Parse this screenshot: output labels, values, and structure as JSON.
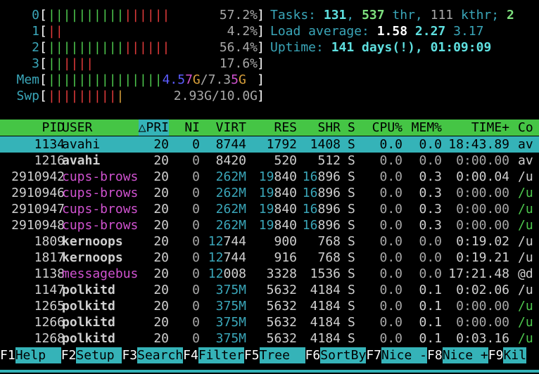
{
  "meters": [
    {
      "label": "0",
      "value": "57.2%",
      "segments": [
        [
          "g",
          "||||||||||"
        ],
        [
          "r",
          "||||||"
        ]
      ]
    },
    {
      "label": "1",
      "value": "4.2%",
      "segments": [
        [
          "r",
          "||"
        ]
      ]
    },
    {
      "label": "2",
      "value": "56.4%",
      "segments": [
        [
          "g",
          "||||||||||"
        ],
        [
          "r",
          "||||||"
        ]
      ]
    },
    {
      "label": "3",
      "value": "17.6%",
      "segments": [
        [
          "g",
          "||"
        ],
        [
          "r",
          "||||"
        ]
      ]
    },
    {
      "label": "Mem",
      "value": "",
      "segments": [
        [
          "g",
          "|||||||||||||||"
        ],
        [
          "b",
          "4.5"
        ],
        [
          "m",
          "7"
        ],
        [
          "o",
          "G"
        ],
        [
          "wt",
          "/7.3"
        ],
        [
          "m",
          "5"
        ],
        [
          "o",
          "G"
        ]
      ]
    },
    {
      "label": "Swp",
      "value": "2.93G/10.0G",
      "segments": [
        [
          "r",
          "|||||||||"
        ],
        [
          "o",
          "|"
        ]
      ]
    }
  ],
  "info": {
    "tasks_label": "Tasks: ",
    "tasks": "131",
    "sep1": ", ",
    "threads": "537",
    "thr_label": " thr, ",
    "kthreads": "111",
    "kthr_label": " kthr; ",
    "running": "2",
    "load_label": "Load average: ",
    "load1": "1.58",
    "load5": "2.27",
    "load15": "3.17",
    "uptime_label": "Uptime: ",
    "uptime": "141 days(!), 01:09:09"
  },
  "columns": {
    "pid": "PID",
    "user": "USER",
    "pri": "△PRI",
    "ni": "NI",
    "virt": "VIRT",
    "res": "RES",
    "shr": "SHR",
    "s": "S",
    "cpu": "CPU%",
    "mem": "MEM%",
    "time": "TIME+",
    "cmd": "Co"
  },
  "processes": [
    {
      "pid": "1134",
      "user": "avahi",
      "pri": "20",
      "ni": "0",
      "virt": "8744",
      "res": "1792",
      "shr": "1408",
      "s": "S",
      "cpu": "0.0",
      "mem": "0.0",
      "time": "18:43.89",
      "cmd": "av",
      "selected": true,
      "ustyle": "b"
    },
    {
      "pid": "1216",
      "user": "avahi",
      "pri": "20",
      "ni": "0",
      "virt": "8420",
      "res": "520",
      "shr": "512",
      "s": "S",
      "cpu": "0.0",
      "mem": "0.0",
      "time": "0:00.00",
      "cmd": "av",
      "ustyle": "b"
    },
    {
      "pid": "2910942",
      "user": "cups-brows",
      "pri": "20",
      "ni": "0",
      "virt": "262M",
      "res": "19840",
      "shr": "16896",
      "s": "S",
      "cpu": "0.0",
      "mem": "0.3",
      "time": "0:00.04",
      "cmd": "/u",
      "ustyle": "m"
    },
    {
      "pid": "2910946",
      "user": "cups-brows",
      "pri": "20",
      "ni": "0",
      "virt": "262M",
      "res": "19840",
      "shr": "16896",
      "s": "S",
      "cpu": "0.0",
      "mem": "0.3",
      "time": "0:00.00",
      "cmd": "/u",
      "ustyle": "m",
      "cg": true
    },
    {
      "pid": "2910947",
      "user": "cups-brows",
      "pri": "20",
      "ni": "0",
      "virt": "262M",
      "res": "19840",
      "shr": "16896",
      "s": "S",
      "cpu": "0.0",
      "mem": "0.3",
      "time": "0:00.00",
      "cmd": "/u",
      "ustyle": "m",
      "cg": true
    },
    {
      "pid": "2910948",
      "user": "cups-brows",
      "pri": "20",
      "ni": "0",
      "virt": "262M",
      "res": "19840",
      "shr": "16896",
      "s": "S",
      "cpu": "0.0",
      "mem": "0.3",
      "time": "0:00.00",
      "cmd": "/u",
      "ustyle": "m",
      "cg": true
    },
    {
      "pid": "1809",
      "user": "kernoops",
      "pri": "20",
      "ni": "0",
      "virt": "12744",
      "res": "900",
      "shr": "768",
      "s": "S",
      "cpu": "0.0",
      "mem": "0.0",
      "time": "0:19.02",
      "cmd": "/u",
      "ustyle": "b"
    },
    {
      "pid": "1817",
      "user": "kernoops",
      "pri": "20",
      "ni": "0",
      "virt": "12744",
      "res": "916",
      "shr": "768",
      "s": "S",
      "cpu": "0.0",
      "mem": "0.0",
      "time": "0:19.21",
      "cmd": "/u",
      "ustyle": "b"
    },
    {
      "pid": "1138",
      "user": "messagebus",
      "pri": "20",
      "ni": "0",
      "virt": "12008",
      "res": "3328",
      "shr": "1536",
      "s": "S",
      "cpu": "0.0",
      "mem": "0.0",
      "time": "17:21.48",
      "cmd": "@d",
      "ustyle": "m"
    },
    {
      "pid": "1147",
      "user": "polkitd",
      "pri": "20",
      "ni": "0",
      "virt": "375M",
      "res": "5632",
      "shr": "4184",
      "s": "S",
      "cpu": "0.0",
      "mem": "0.1",
      "time": "0:02.06",
      "cmd": "/u",
      "ustyle": "b"
    },
    {
      "pid": "1265",
      "user": "polkitd",
      "pri": "20",
      "ni": "0",
      "virt": "375M",
      "res": "5632",
      "shr": "4184",
      "s": "S",
      "cpu": "0.0",
      "mem": "0.1",
      "time": "0:00.00",
      "cmd": "/u",
      "ustyle": "b",
      "cg": true
    },
    {
      "pid": "1266",
      "user": "polkitd",
      "pri": "20",
      "ni": "0",
      "virt": "375M",
      "res": "5632",
      "shr": "4184",
      "s": "S",
      "cpu": "0.0",
      "mem": "0.1",
      "time": "0:00.00",
      "cmd": "/u",
      "ustyle": "b",
      "cg": true
    },
    {
      "pid": "1268",
      "user": "polkitd",
      "pri": "20",
      "ni": "0",
      "virt": "375M",
      "res": "5632",
      "shr": "4184",
      "s": "S",
      "cpu": "0.0",
      "mem": "0.1",
      "time": "0:03.16",
      "cmd": "/u",
      "ustyle": "b",
      "cg": true
    }
  ],
  "function_keys": [
    {
      "key": "F1",
      "label": "Help  "
    },
    {
      "key": "F2",
      "label": "Setup "
    },
    {
      "key": "F3",
      "label": "Search"
    },
    {
      "key": "F4",
      "label": "Filter"
    },
    {
      "key": "F5",
      "label": "Tree  "
    },
    {
      "key": "F6",
      "label": "SortBy"
    },
    {
      "key": "F7",
      "label": "Nice -"
    },
    {
      "key": "F8",
      "label": "Nice +"
    },
    {
      "key": "F9",
      "label": "Kil"
    }
  ]
}
